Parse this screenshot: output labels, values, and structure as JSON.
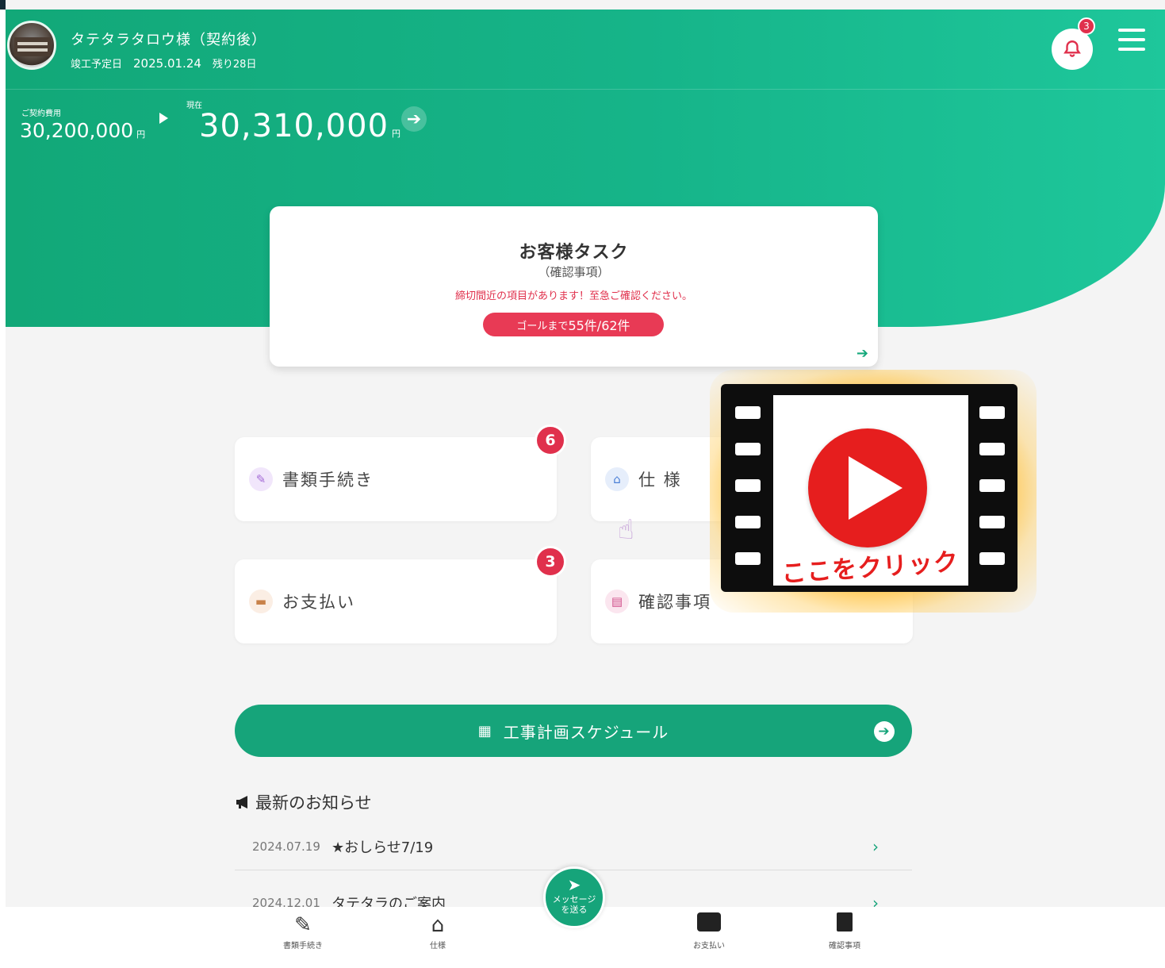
{
  "header": {
    "user_name": "タテタラタロウ様（契約後）",
    "completion_label": "竣工予定日",
    "completion_date": "2025.01.24",
    "remaining": "残り28日",
    "notification_count": "3"
  },
  "price": {
    "contract_label": "ご契約費用",
    "contract_value": "30,200,000",
    "current_label": "現在",
    "current_value": "30,310,000",
    "unit": "円"
  },
  "task_card": {
    "title": "お客様タスク",
    "subtitle": "（確認事項）",
    "warning": "締切間近の項目があります！至急ご確認ください。",
    "goal_prefix": "ゴールまで",
    "goal_value": "55件/62件"
  },
  "menu": [
    {
      "label": "書類手続き",
      "badge": "6",
      "icon": "edit-icon",
      "icon_color": "#a46bd6",
      "icon_bg": "#f1e6fb"
    },
    {
      "label": "仕 様",
      "badge": "",
      "icon": "home-icon",
      "icon_color": "#4a7fd6",
      "icon_bg": "#e6eefb"
    },
    {
      "label": "お支払い",
      "badge": "3",
      "icon": "wallet-icon",
      "icon_color": "#c8824a",
      "icon_bg": "#fbeee4"
    },
    {
      "label": "確認事項",
      "badge": "",
      "icon": "document-icon",
      "icon_color": "#d14f8a",
      "icon_bg": "#fbe6ef"
    }
  ],
  "video_overlay": {
    "text": "ここをクリック"
  },
  "schedule_button": {
    "label": "工事計画スケジュール"
  },
  "news": {
    "title": "最新のお知らせ",
    "items": [
      {
        "date": "2024.07.19",
        "text": "★おしらせ7/19"
      },
      {
        "date": "2024.12.01",
        "text": "タテタラのご案内"
      }
    ]
  },
  "bottom_nav": {
    "items": [
      "書類手続き",
      "仕様",
      "お支払い",
      "確認事項"
    ],
    "message_line1": "メッセージ",
    "message_line2": "を送る"
  },
  "colors": {
    "primary": "#16a47a",
    "alert": "#e0304c",
    "play_red": "#e61e1e"
  }
}
